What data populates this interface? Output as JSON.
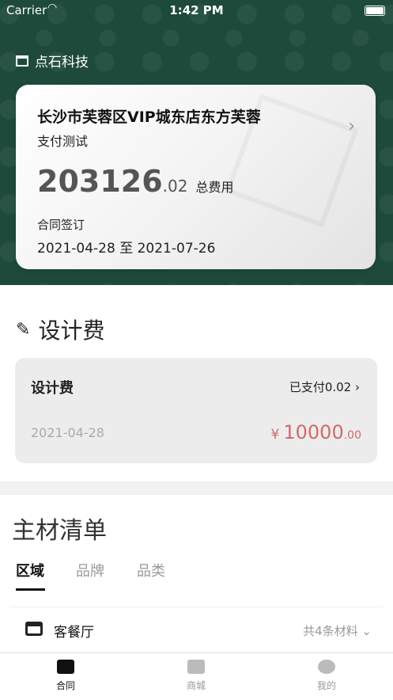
{
  "status": {
    "carrier": "Carrier",
    "time": "1:42 PM"
  },
  "company": {
    "name": "点石科技"
  },
  "contract": {
    "title": "长沙市芙蓉区VIP城东店东方芙蓉",
    "subtitle": "支付测试",
    "amount_int": "203126",
    "amount_dec": ".02",
    "amount_label": "总费用",
    "sign_label": "合同签订",
    "dates": "2021-04-28 至 2021-07-26"
  },
  "design": {
    "section_title": "设计费",
    "card_title": "设计费",
    "paid": "已支付0.02",
    "date": "2021-04-28",
    "currency": "¥",
    "price_int": "10000",
    "price_dec": ".00"
  },
  "materials": {
    "title": "主材清单",
    "tabs": [
      "区域",
      "品牌",
      "品类"
    ],
    "rooms": [
      {
        "name": "客餐厅",
        "count": "共4条材料"
      }
    ]
  },
  "tabbar": {
    "items": [
      "合同",
      "商城",
      "我的"
    ]
  },
  "colors": {
    "primary": "#1d4a3b",
    "price": "#d06a6a"
  }
}
